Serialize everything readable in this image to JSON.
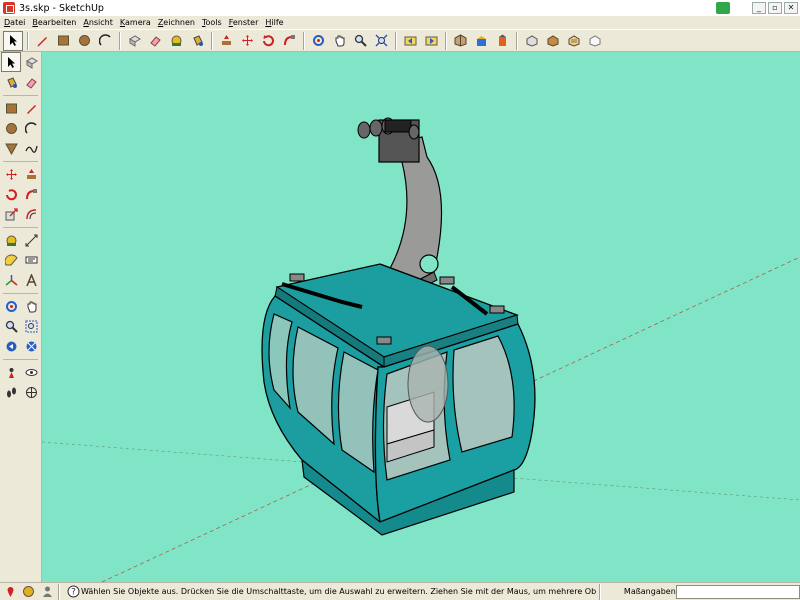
{
  "window": {
    "title": "3s.skp - SketchUp"
  },
  "menu": [
    "Datei",
    "Bearbeiten",
    "Ansicht",
    "Kamera",
    "Zeichnen",
    "Tools",
    "Fenster",
    "Hilfe"
  ],
  "toolbar": {
    "icons": [
      "select-icon",
      "pencil-icon",
      "rectangle-icon",
      "circle-icon",
      "arc-icon",
      "eraser-icon",
      "paint-bucket-icon",
      "push-pull-icon",
      "move-icon",
      "rotate-icon",
      "follow-me-icon",
      "orbit-icon",
      "pan-icon",
      "zoom-icon",
      "zoom-extents-icon",
      "iso-view-icon",
      "top-view-icon",
      "front-view-icon",
      "side-view-icon",
      "xray-icon",
      "wireframe-icon",
      "shaded-icon",
      "textured-icon"
    ]
  },
  "status": {
    "message": "Wählen Sie Objekte aus. Drücken Sie die Umschalttaste, um die Auswahl zu erweitern. Ziehen Sie mit der Maus, um mehrere Objekte",
    "measure_label": "Maßangaben",
    "measure_value": ""
  },
  "colors": {
    "viewport_bg": "#80e5c7",
    "cabin_teal": "#1c9ea0",
    "hanger_gray": "#9a9a98"
  }
}
